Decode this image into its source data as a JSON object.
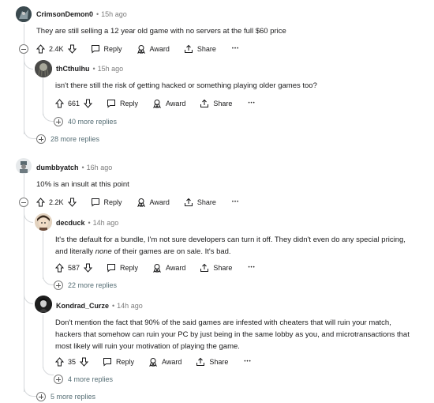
{
  "comments": [
    {
      "author": "CrimsonDemon0",
      "time": "15h ago",
      "text": "They are still selling a 12 year old game with no servers at the full $60 price",
      "votes": "2.4K",
      "more_replies": "28 more replies"
    },
    {
      "author": "thCthulhu",
      "time": "15h ago",
      "text": "isn't there still the risk of getting hacked or something playing older games too?",
      "votes": "661",
      "more_replies": "40 more replies"
    },
    {
      "author": "dumbbyatch",
      "time": "16h ago",
      "text": "10% is an insult at this point",
      "votes": "2.2K",
      "more_replies": "5 more replies"
    },
    {
      "author": "decduck",
      "time": "14h ago",
      "text_part1": "It's the default for a bundle, I'm not sure developers can turn it off. They didn't even do any special pricing,",
      "text_part2": "and literally ",
      "text_em": "none",
      "text_part3": " of their games are on sale. It's bad.",
      "votes": "587",
      "more_replies": "22 more replies"
    },
    {
      "author": "Kondrad_Curze",
      "time": "14h ago",
      "text_line1": "Don't mention the fact that 90% of the said games are infested with cheaters that will ruin your match,",
      "text_line2": "hackers that somehow can ruin your PC by just being in the same lobby as you, and microtransactions that",
      "text_line3": "most likely will ruin your motivation of playing the game.",
      "votes": "35",
      "more_replies": "4 more replies"
    }
  ],
  "labels": {
    "reply": "Reply",
    "award": "Award",
    "share": "Share",
    "more": "•••",
    "dot": "•"
  },
  "icons": [
    "upvote-icon",
    "downvote-icon",
    "reply-icon",
    "award-icon",
    "share-icon",
    "more-icon",
    "expand-icon",
    "collapse-icon"
  ]
}
